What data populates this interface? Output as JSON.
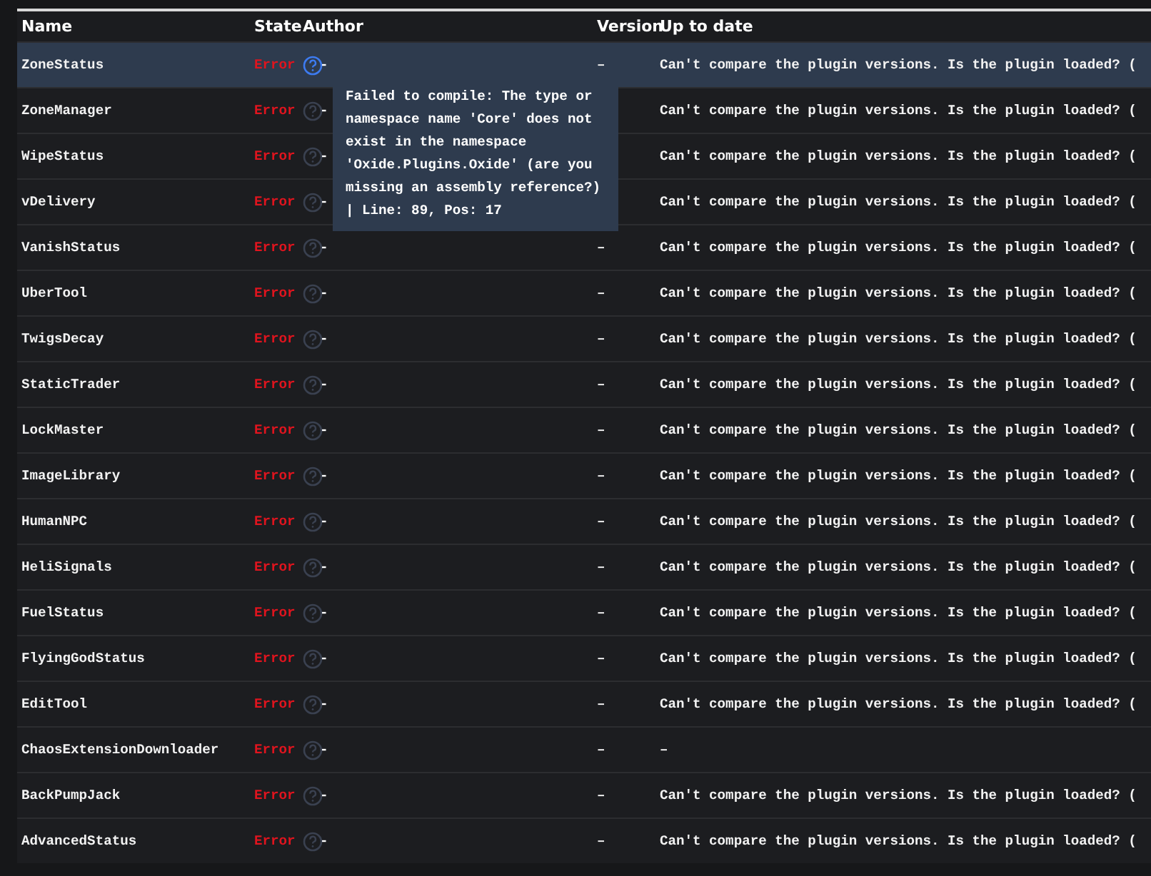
{
  "table": {
    "columns": [
      "Name",
      "State",
      "Author",
      "Version",
      "Up to date"
    ],
    "rows": [
      {
        "name": "ZoneStatus",
        "state": "Error",
        "author": "-",
        "version": "–",
        "up_to_date": "Can't compare the plugin versions. Is the plugin loaded? (",
        "selected": true
      },
      {
        "name": "ZoneManager",
        "state": "Error",
        "author": "-",
        "up_to_date": "Can't compare the plugin versions. Is the plugin loaded? (",
        "selected": false
      },
      {
        "name": "WipeStatus",
        "state": "Error",
        "author": "-",
        "up_to_date": "Can't compare the plugin versions. Is the plugin loaded? (",
        "selected": false
      },
      {
        "name": "vDelivery",
        "state": "Error",
        "author": "-",
        "up_to_date": "Can't compare the plugin versions. Is the plugin loaded? (",
        "selected": false
      },
      {
        "name": "VanishStatus",
        "state": "Error",
        "author": "-",
        "version": "–",
        "up_to_date": "Can't compare the plugin versions. Is the plugin loaded? (",
        "selected": false
      },
      {
        "name": "UberTool",
        "state": "Error",
        "author": "-",
        "version": "–",
        "up_to_date": "Can't compare the plugin versions. Is the plugin loaded? (",
        "selected": false
      },
      {
        "name": "TwigsDecay",
        "state": "Error",
        "author": "-",
        "version": "–",
        "up_to_date": "Can't compare the plugin versions. Is the plugin loaded? (",
        "selected": false
      },
      {
        "name": "StaticTrader",
        "state": "Error",
        "author": "-",
        "version": "–",
        "up_to_date": "Can't compare the plugin versions. Is the plugin loaded? (",
        "selected": false
      },
      {
        "name": "LockMaster",
        "state": "Error",
        "author": "-",
        "version": "–",
        "up_to_date": "Can't compare the plugin versions. Is the plugin loaded? (",
        "selected": false
      },
      {
        "name": "ImageLibrary",
        "state": "Error",
        "author": "-",
        "version": "–",
        "up_to_date": "Can't compare the plugin versions. Is the plugin loaded? (",
        "selected": false
      },
      {
        "name": "HumanNPC",
        "state": "Error",
        "author": "-",
        "version": "–",
        "up_to_date": "Can't compare the plugin versions. Is the plugin loaded? (",
        "selected": false
      },
      {
        "name": "HeliSignals",
        "state": "Error",
        "author": "-",
        "version": "–",
        "up_to_date": "Can't compare the plugin versions. Is the plugin loaded? (",
        "selected": false
      },
      {
        "name": "FuelStatus",
        "state": "Error",
        "author": "-",
        "version": "–",
        "up_to_date": "Can't compare the plugin versions. Is the plugin loaded? (",
        "selected": false
      },
      {
        "name": "FlyingGodStatus",
        "state": "Error",
        "author": "-",
        "version": "–",
        "up_to_date": "Can't compare the plugin versions. Is the plugin loaded? (",
        "selected": false
      },
      {
        "name": "EditTool",
        "state": "Error",
        "author": "-",
        "version": "–",
        "up_to_date": "Can't compare the plugin versions. Is the plugin loaded? (",
        "selected": false
      },
      {
        "name": "ChaosExtensionDownloader",
        "state": "Error",
        "author": "-",
        "version": "–",
        "up_to_date": "–",
        "selected": false
      },
      {
        "name": "BackPumpJack",
        "state": "Error",
        "author": "-",
        "version": "–",
        "up_to_date": "Can't compare the plugin versions. Is the plugin loaded? (",
        "selected": false
      },
      {
        "name": "AdvancedStatus",
        "state": "Error",
        "author": "-",
        "version": "–",
        "up_to_date": "Can't compare the plugin versions. Is the plugin loaded? (",
        "selected": false
      }
    ]
  },
  "tooltip": {
    "text": "Failed to compile: The type or namespace name 'Core' does not exist in the namespace 'Oxide.Plugins.Oxide' (are you missing an assembly reference?) | Line: 89, Pos: 17"
  }
}
